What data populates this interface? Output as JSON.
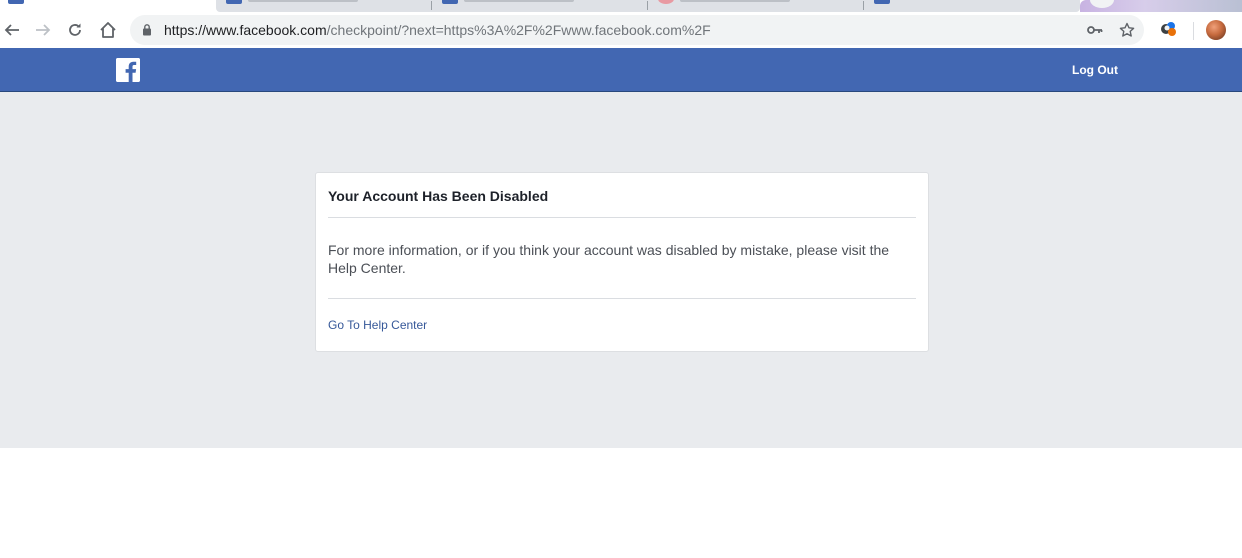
{
  "browser": {
    "url_host": "https://www.facebook.com",
    "url_path": "/checkpoint/?next=https%3A%2F%2Fwww.facebook.com%2F",
    "icons": {
      "back": "back-arrow-icon",
      "forward": "forward-arrow-icon",
      "reload": "reload-icon",
      "home": "home-icon",
      "lock": "lock-icon",
      "key": "key-icon",
      "star": "star-icon",
      "extension": "extension-icon",
      "profile": "profile-avatar"
    }
  },
  "header": {
    "logout_label": "Log Out",
    "background": "#4267b2"
  },
  "card": {
    "title": "Your Account Has Been Disabled",
    "message": "For more information, or if you think your account was disabled by mistake, please visit the Help Center.",
    "link_label": "Go To Help Center"
  },
  "colors": {
    "page_background": "#e9ebee",
    "link": "#365899",
    "brand": "#4267b2"
  }
}
